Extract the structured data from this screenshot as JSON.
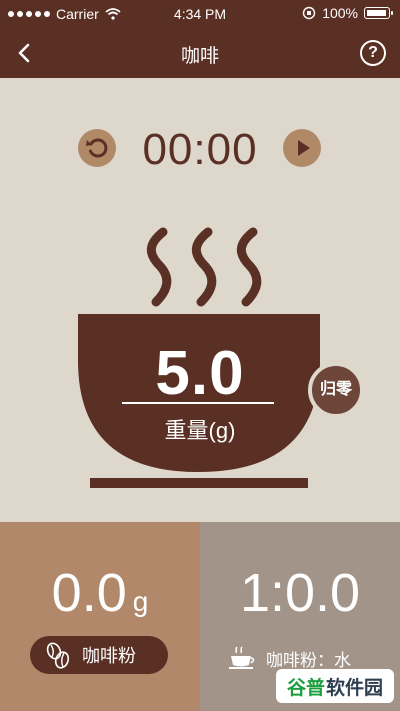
{
  "status_bar": {
    "carrier": "Carrier",
    "time": "4:34 PM",
    "battery": "100%",
    "battery_level": 1.0
  },
  "nav": {
    "title": "咖啡",
    "help": "?"
  },
  "timer": {
    "value": "00:00"
  },
  "scale": {
    "weight": "5.0",
    "label": "重量(g)",
    "zero_button": "归零"
  },
  "panels": {
    "coffee_amount": "0.0",
    "coffee_unit": "g",
    "bean_button": "咖啡粉",
    "ratio": "1:0.0",
    "ratio_label": "咖啡粉：水"
  },
  "watermark": {
    "part1": "谷普",
    "part2": "软件园"
  },
  "colors": {
    "brand_dark": "#5a2f24",
    "background": "#ddd7cc",
    "left_panel": "#b1886a",
    "right_panel": "#a29488",
    "accent_button": "#b08967"
  }
}
